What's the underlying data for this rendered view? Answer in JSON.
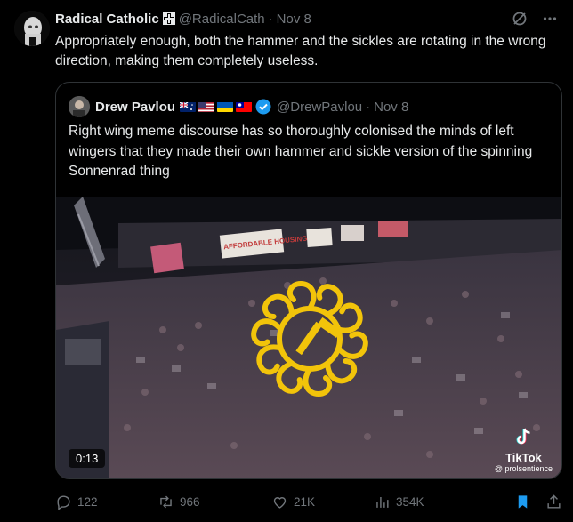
{
  "tweet": {
    "author_name": "Radical Catholic",
    "handle": "@RadicalCath",
    "separator": "·",
    "date": "Nov 8",
    "text": "Appropriately enough, both the hammer and the sickles are rotating in the wrong direction, making them completely useless."
  },
  "quote": {
    "author_name": "Drew Pavlou",
    "handle": "@DrewPavlou",
    "separator": "·",
    "date": "Nov 8",
    "flags": [
      "australia-flag",
      "usa-flag",
      "ukraine-flag",
      "taiwan-flag"
    ],
    "text": "Right wing meme discourse has so thoroughly colonised the minds of left wingers that they made their own hammer and sickle version of the spinning Sonnenrad thing",
    "media": {
      "timestamp": "0:13",
      "watermark": "TikTok",
      "watermark_user": "@ prolsentience",
      "signs": [
        "AFFORDABLE HOUSING"
      ]
    }
  },
  "actions": {
    "replies": "122",
    "reposts": "966",
    "likes": "21K",
    "views": "354K"
  },
  "colors": {
    "background": "#000000",
    "text": "#e7e9ea",
    "muted": "#71767b",
    "accent": "#1d9bf0",
    "emblem": "#f2c40a"
  }
}
